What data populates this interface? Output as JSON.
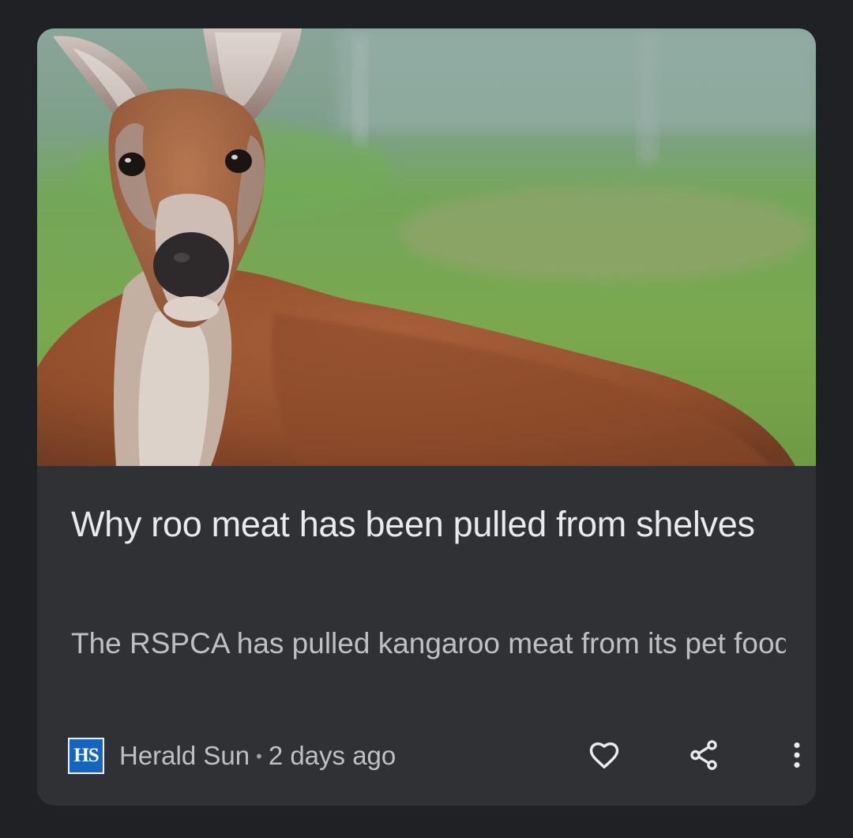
{
  "article": {
    "headline": "Why roo meat has been pulled from shelves",
    "snippet": "The RSPCA has pulled kangaroo meat from its pet food shelves amid animal welfare concerns…",
    "image_subject": "red kangaroo portrait on green grass"
  },
  "source": {
    "logo_text": "HS",
    "name": "Herald Sun",
    "separator": "•",
    "age": "2 days ago"
  },
  "actions": {
    "like_icon": "heart-outline-icon",
    "share_icon": "share-icon",
    "more_icon": "more-vert-icon"
  },
  "colors": {
    "background": "#202124",
    "card": "#303134",
    "headline": "#e8eaed",
    "secondary_text": "#bdc1c6",
    "logo_blue": "#1565c0"
  }
}
